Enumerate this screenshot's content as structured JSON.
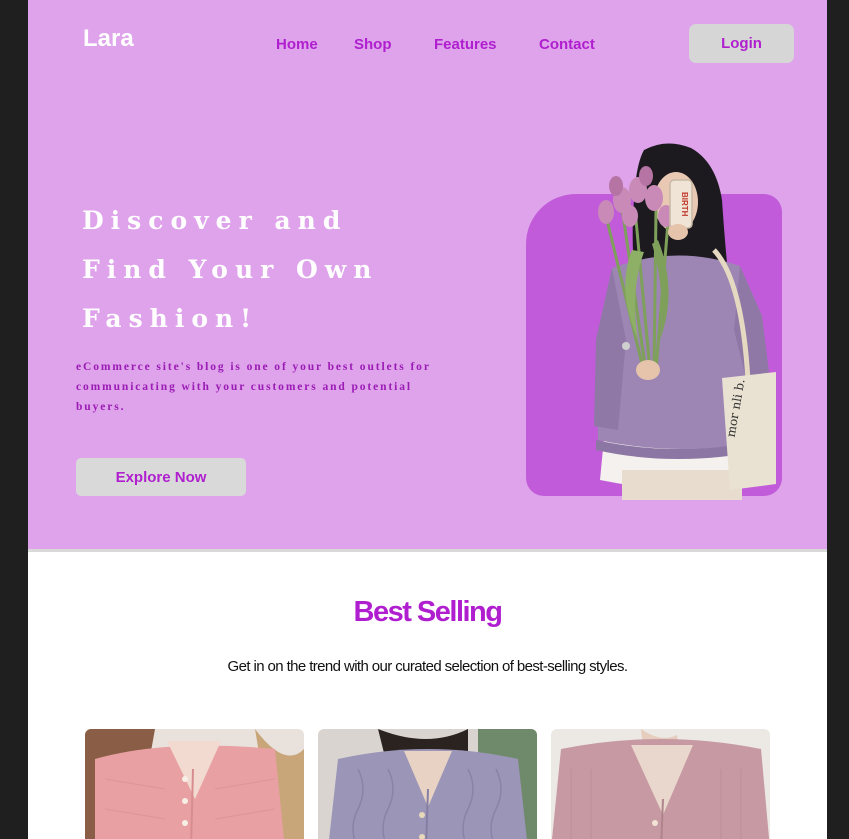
{
  "brand": {
    "name": "Lara"
  },
  "nav": {
    "items": [
      {
        "label": "Home"
      },
      {
        "label": "Shop"
      },
      {
        "label": "Features"
      },
      {
        "label": "Contact"
      }
    ],
    "login_label": "Login"
  },
  "hero": {
    "title_lines": [
      "Discover and",
      "Find Your Own",
      "Fashion!"
    ],
    "description": "eCommerce site's blog is one of your best outlets for communicating with your customers and potential buyers.",
    "cta_label": "Explore Now",
    "phone_case_text": "BIRTH",
    "tote_text": "mor nli b."
  },
  "best_selling": {
    "title": "Best Selling",
    "subtitle": "Get in on the trend with our curated selection of best-selling styles.",
    "products": [
      {
        "image": "pink-knit-cardigan-photo"
      },
      {
        "image": "lavender-cable-knit-cardigan-photo"
      },
      {
        "image": "mauve-v-neck-cardigan-photo"
      }
    ]
  },
  "colors": {
    "hero_bg": "#dea3ea",
    "accent": "#b01fcf",
    "image_shape": "#c15bd9",
    "button_bg": "#d9d9d9"
  }
}
